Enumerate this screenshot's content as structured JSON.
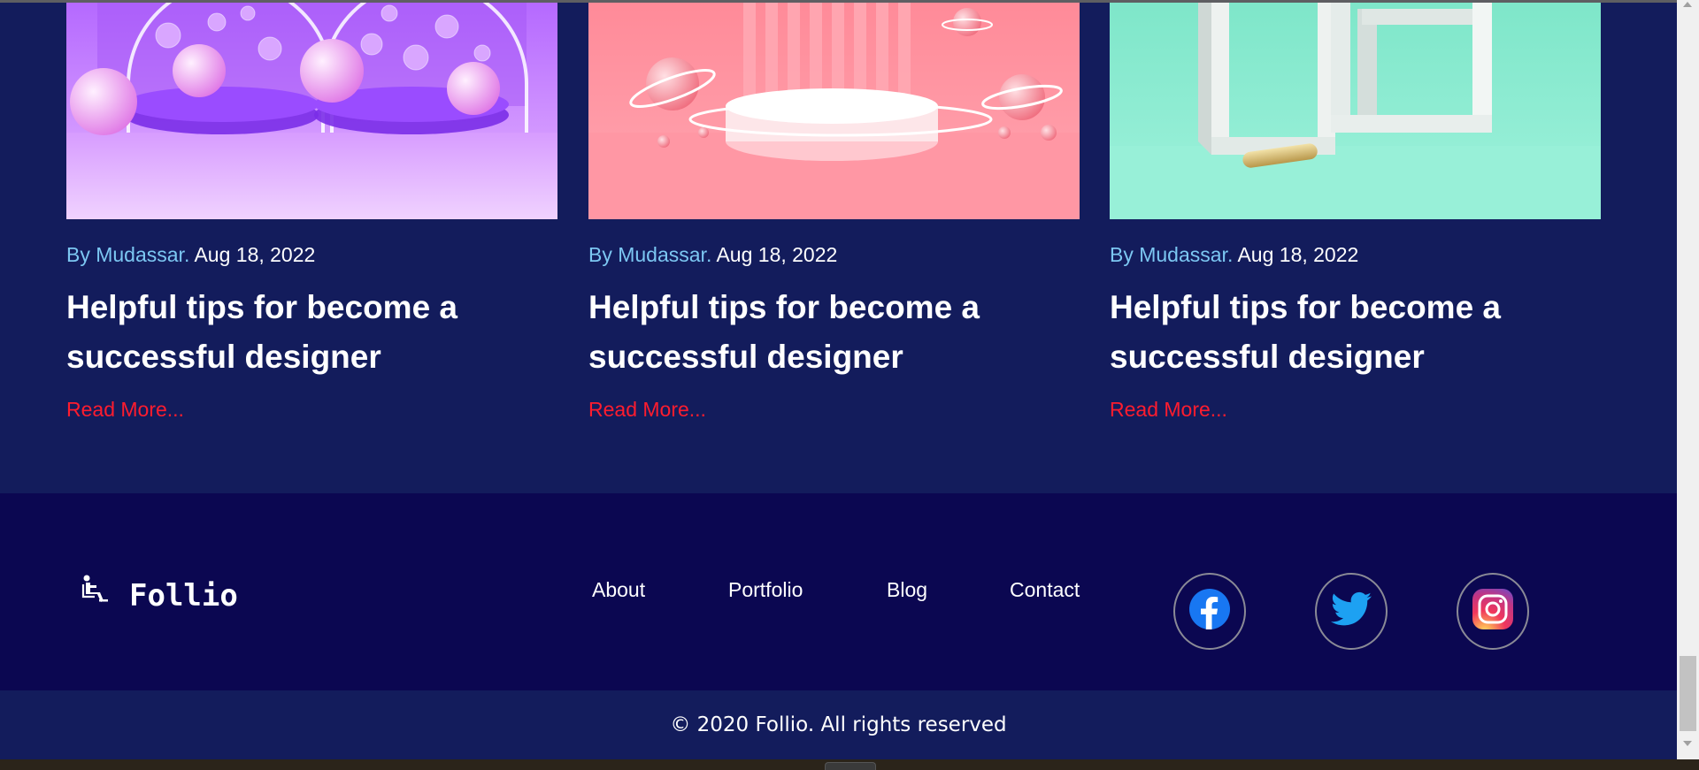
{
  "posts": [
    {
      "by": "By Mudassar.",
      "date": " Aug 18, 2022",
      "title": "Helpful tips for become a successful designer",
      "read_more": "Read More..."
    },
    {
      "by": "By Mudassar.",
      "date": " Aug 18, 2022",
      "title": "Helpful tips for become a successful designer",
      "read_more": "Read More..."
    },
    {
      "by": "By Mudassar.",
      "date": " Aug 18, 2022",
      "title": "Helpful tips for become a successful designer",
      "read_more": "Read More..."
    }
  ],
  "footer": {
    "brand": "Follio",
    "nav": [
      "About",
      "Portfolio",
      "Blog",
      "Contact"
    ],
    "social": [
      "facebook-icon",
      "twitter-icon",
      "instagram-icon"
    ],
    "copyright": "© 2020 Follio. All rights reserved"
  },
  "colors": {
    "page_bg": "#131c5c",
    "footer_bg": "#0b0751",
    "author_link": "#7cc7f2",
    "read_more": "#ff1c2e",
    "facebook": "#1877f2",
    "twitter": "#1da1f2"
  }
}
